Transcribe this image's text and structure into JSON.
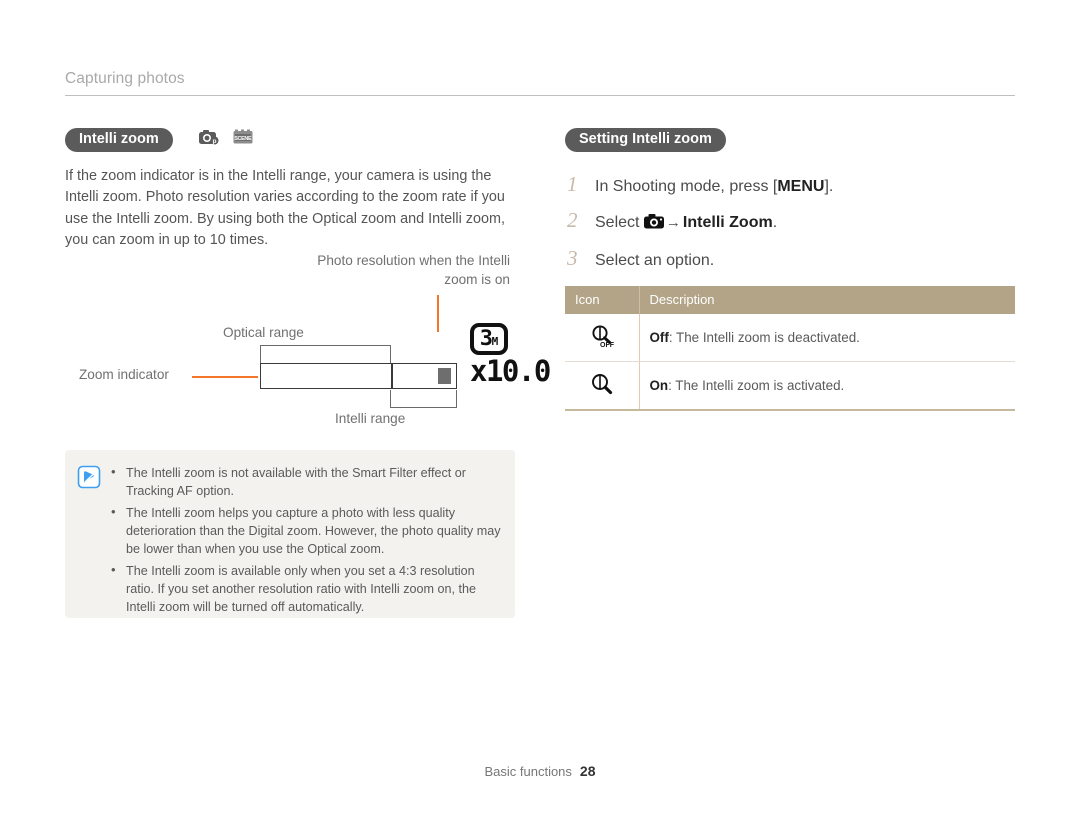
{
  "header": {
    "breadcrumb": "Capturing photos"
  },
  "left": {
    "section_title": "Intelli zoom",
    "mode_icons": [
      {
        "name": "program-mode-icon",
        "label": "Program mode"
      },
      {
        "name": "scene-mode-icon",
        "label": "SCENE"
      }
    ],
    "intro_paragraph": "If the zoom indicator is in the Intelli range, your camera is using the Intelli zoom. Photo resolution varies according to the zoom rate if you use the Intelli zoom. By using both the Optical zoom and Intelli zoom, you can zoom in up to 10 times.",
    "diagram": {
      "callout_resolution": "Photo resolution when the Intelli zoom is on",
      "label_optical_range": "Optical range",
      "label_zoom_indicator": "Zoom indicator",
      "label_intelli_range": "Intelli range",
      "lcd_resolution_number": "3",
      "lcd_resolution_unit": "M",
      "lcd_zoom_factor": "x10.0",
      "leader_color": "#f2772a"
    },
    "note": {
      "icon": "note-pen-icon",
      "items": [
        "The Intelli zoom is not available with the Smart Filter effect or Tracking AF option.",
        "The Intelli zoom helps you capture a photo with less quality deterioration than the Digital zoom. However, the photo quality may be lower than when you use the Optical zoom.",
        "The Intelli zoom is available only when you set a 4:3 resolution ratio. If you set another resolution ratio with Intelli zoom on, the Intelli zoom will be turned off automatically."
      ]
    }
  },
  "right": {
    "section_title": "Setting Intelli zoom",
    "steps": [
      {
        "num": "1",
        "text_before": "In Shooting mode, press [",
        "bold": "MENU",
        "text_after": "]."
      },
      {
        "num": "2",
        "text_before": "Select ",
        "icon": "camera-icon",
        "arrow": "→",
        "bold": "Intelli Zoom",
        "text_after": "."
      },
      {
        "num": "3",
        "text_before": "Select an option.",
        "bold": "",
        "text_after": ""
      }
    ],
    "table": {
      "headers": [
        "Icon",
        "Description"
      ],
      "rows": [
        {
          "icon": "intelli-zoom-off-icon",
          "label": "Off",
          "description": ": The Intelli zoom is deactivated."
        },
        {
          "icon": "intelli-zoom-on-icon",
          "label": "On",
          "description": ": The Intelli zoom is activated."
        }
      ],
      "header_color": "#b3a488"
    }
  },
  "footer": {
    "chapter": "Basic functions",
    "page": "28"
  }
}
